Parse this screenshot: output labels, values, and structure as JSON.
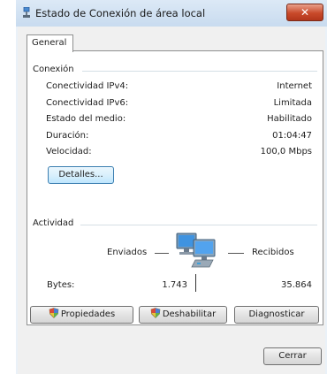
{
  "window": {
    "title": "Estado de Conexión de área local",
    "close_label": "✕"
  },
  "tab": {
    "label": "General"
  },
  "connection": {
    "legend": "Conexión",
    "rows": [
      {
        "label": "Conectividad IPv4:",
        "value": "Internet"
      },
      {
        "label": "Conectividad IPv6:",
        "value": "Limitada"
      },
      {
        "label": "Estado del medio:",
        "value": "Habilitado"
      },
      {
        "label": "Duración:",
        "value": "01:04:47"
      },
      {
        "label": "Velocidad:",
        "value": "100,0 Mbps"
      }
    ],
    "details_button": "Detalles..."
  },
  "activity": {
    "legend": "Actividad",
    "sent_label": "Enviados",
    "received_label": "Recibidos",
    "bytes_label": "Bytes:",
    "bytes_sent": "1.743",
    "bytes_received": "35.864"
  },
  "buttons": {
    "properties": "Propiedades",
    "disable": "Deshabilitar",
    "diagnose": "Diagnosticar",
    "close": "Cerrar"
  },
  "icons": [
    "network-icon",
    "shield-icon",
    "network-computers-icon"
  ]
}
